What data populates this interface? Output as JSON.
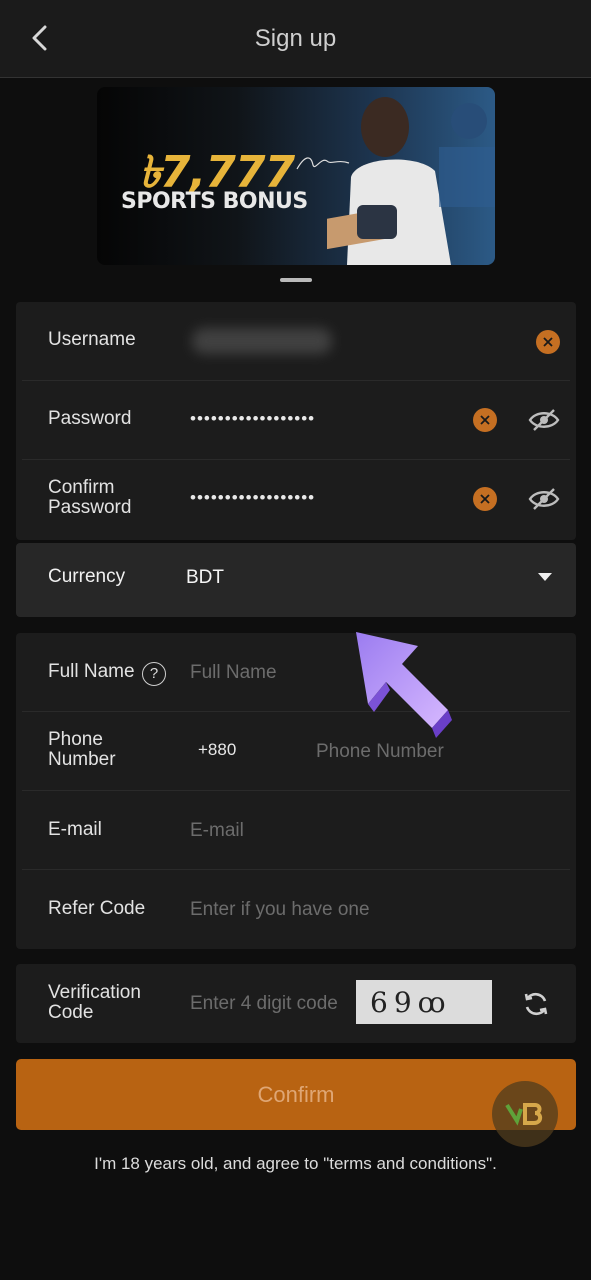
{
  "header": {
    "title": "Sign up",
    "back_icon": "chevron-left-icon"
  },
  "banner": {
    "amount": "৳7,777",
    "label": "SPORTS BONUS"
  },
  "account_fields": {
    "username": {
      "label": "Username"
    },
    "password": {
      "label": "Password",
      "value": "••••••••••••••••••"
    },
    "confirm_password": {
      "label_line1": "Confirm",
      "label_line2": "Password",
      "value": "••••••••••••••••••"
    }
  },
  "currency": {
    "label": "Currency",
    "value": "BDT"
  },
  "profile_fields": {
    "full_name": {
      "label": "Full Name",
      "placeholder": "Full Name"
    },
    "phone": {
      "label_line1": "Phone",
      "label_line2": "Number",
      "prefix": "+880",
      "placeholder": "Phone Number"
    },
    "email": {
      "label": "E-mail",
      "placeholder": "E-mail"
    },
    "refer": {
      "label": "Refer Code",
      "placeholder": "Enter if you have one"
    }
  },
  "verification": {
    "label_line1": "Verification",
    "label_line2": "Code",
    "placeholder": "Enter 4 digit code",
    "captcha_text": "69ꝏ"
  },
  "confirm_button": {
    "label": "Confirm"
  },
  "terms_text": "I'm 18 years old, and agree to \"terms and conditions\".",
  "colors": {
    "accent": "#b86312",
    "clear_icon": "#c56f22",
    "background": "#0e0e0e",
    "card": "#1c1c1c"
  }
}
